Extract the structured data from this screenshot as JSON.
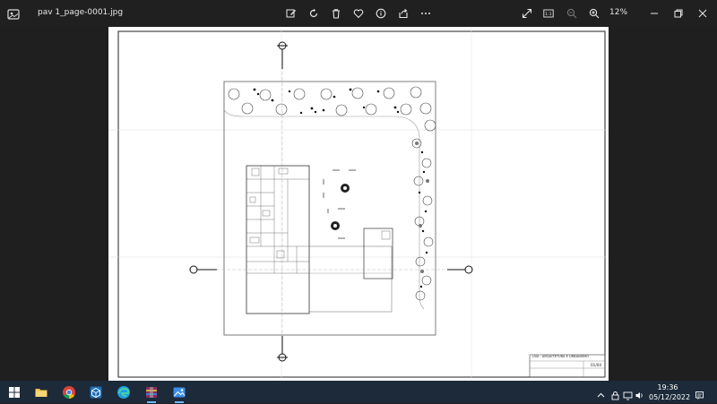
{
  "window": {
    "filename": "pav 1_page-0001.jpg",
    "zoom": "12%",
    "toolbar_icons": [
      "edit-icon",
      "rotate-icon",
      "delete-icon",
      "favorite-icon",
      "info-icon",
      "share-icon",
      "more-icon"
    ],
    "right_icons": [
      "fullscreen-icon",
      "actual-size-icon",
      "zoom-out-icon",
      "zoom-in-icon"
    ],
    "controls": [
      "minimize-icon",
      "restore-icon",
      "close-icon"
    ]
  },
  "drawing": {
    "titleblock": {
      "institution": "UVA - ARQUITETURA E URBANISMO",
      "sheet": "01/04"
    }
  },
  "taskbar": {
    "apps": [
      "start-icon",
      "file-explorer-icon",
      "chrome-icon",
      "sketchup-icon",
      "edge-icon",
      "winrar-icon",
      "photos-icon"
    ],
    "time": "19:36",
    "date": "05/12/2022"
  }
}
